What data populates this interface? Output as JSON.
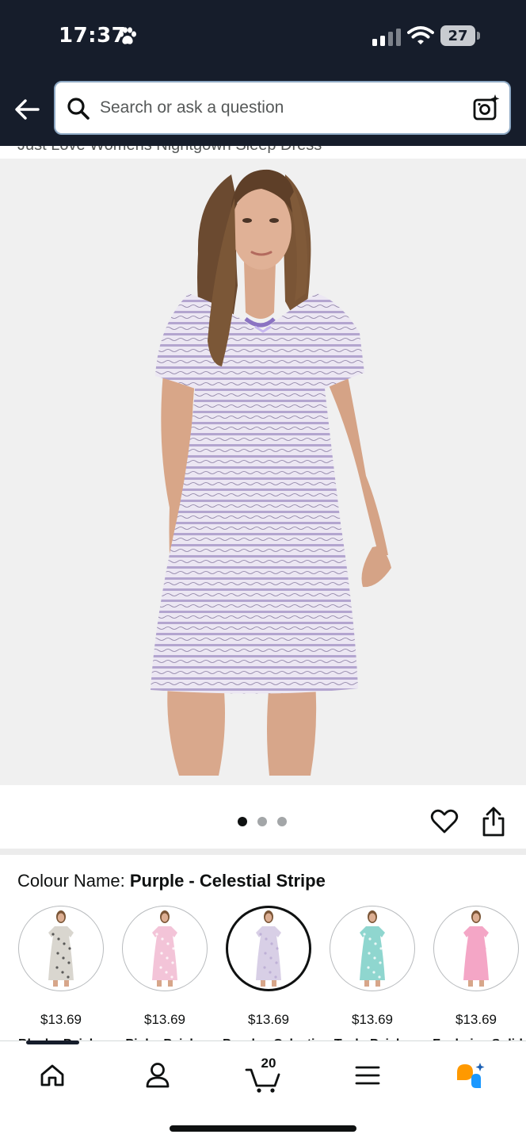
{
  "status_bar": {
    "time": "17:37",
    "battery": "27"
  },
  "header": {
    "back_label": "Back",
    "search_placeholder": "Search or ask a question"
  },
  "product": {
    "title": "Just Love Womens Nightgown Sleep Dress",
    "image_count": 3,
    "active_image": 1
  },
  "colour": {
    "label": "Colour Name: ",
    "selected": "Purple - Celestial Stripe"
  },
  "swatches": [
    {
      "price": "$13.69",
      "name": "Black - Paisley",
      "dress_color": "#d9d6cf",
      "pattern_color": "#3a3a3a",
      "selected": false
    },
    {
      "price": "$13.69",
      "name": "Pink - Paisley",
      "dress_color": "#f3c4d8",
      "pattern_color": "#ffffff",
      "selected": false
    },
    {
      "price": "$13.69",
      "name": "Purple - Celestial Stripe",
      "dress_color": "#d8cfe6",
      "pattern_color": "#b8a8d2",
      "selected": true
    },
    {
      "price": "$13.69",
      "name": "Teal - Paisley",
      "dress_color": "#8fd6cf",
      "pattern_color": "#ffffff",
      "selected": false
    },
    {
      "price": "$13.69",
      "name": "Fuchsia - Solid",
      "dress_color": "#f4a6c6",
      "pattern_color": "#f4a6c6",
      "selected": false
    }
  ],
  "bottom_nav": {
    "items": [
      "home-icon",
      "account-icon",
      "cart-icon",
      "menu-icon",
      "rufus-icon"
    ],
    "cart_count": "20"
  },
  "colors": {
    "header_bg": "#161d2b",
    "accent_orange": "#ff9900",
    "accent_blue": "#1a98ff"
  }
}
